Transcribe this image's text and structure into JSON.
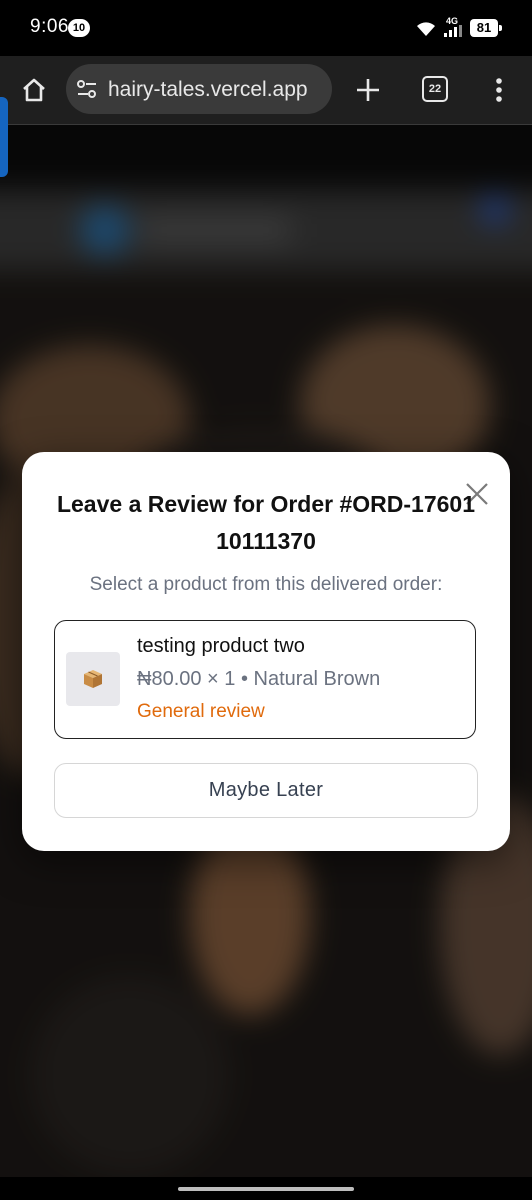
{
  "status_bar": {
    "time": "9:06",
    "notification_count": "10",
    "network_label": "4G",
    "battery_level": "81",
    "icons": [
      "wifi-icon",
      "signal-icon",
      "battery-icon"
    ]
  },
  "browser": {
    "url": "hairy-tales.vercel.app",
    "tab_count": "22",
    "icons": [
      "home-icon",
      "tune-icon",
      "plus-icon",
      "tabs-icon",
      "more-vert-icon"
    ]
  },
  "modal": {
    "title": "Leave a Review for Order #ORD-1760110111370",
    "subtitle": "Select a product from this delivered order:",
    "product": {
      "name": "testing product two",
      "meta": "₦80.00 × 1 • Natural Brown",
      "review_label": "General review",
      "thumbnail_icon": "package-icon"
    },
    "dismiss_label": "Maybe Later",
    "close_icon": "close-icon"
  },
  "colors": {
    "accent_orange": "#e06a0c",
    "muted_text": "#6b7280",
    "side_tab_blue": "#1565c0"
  }
}
